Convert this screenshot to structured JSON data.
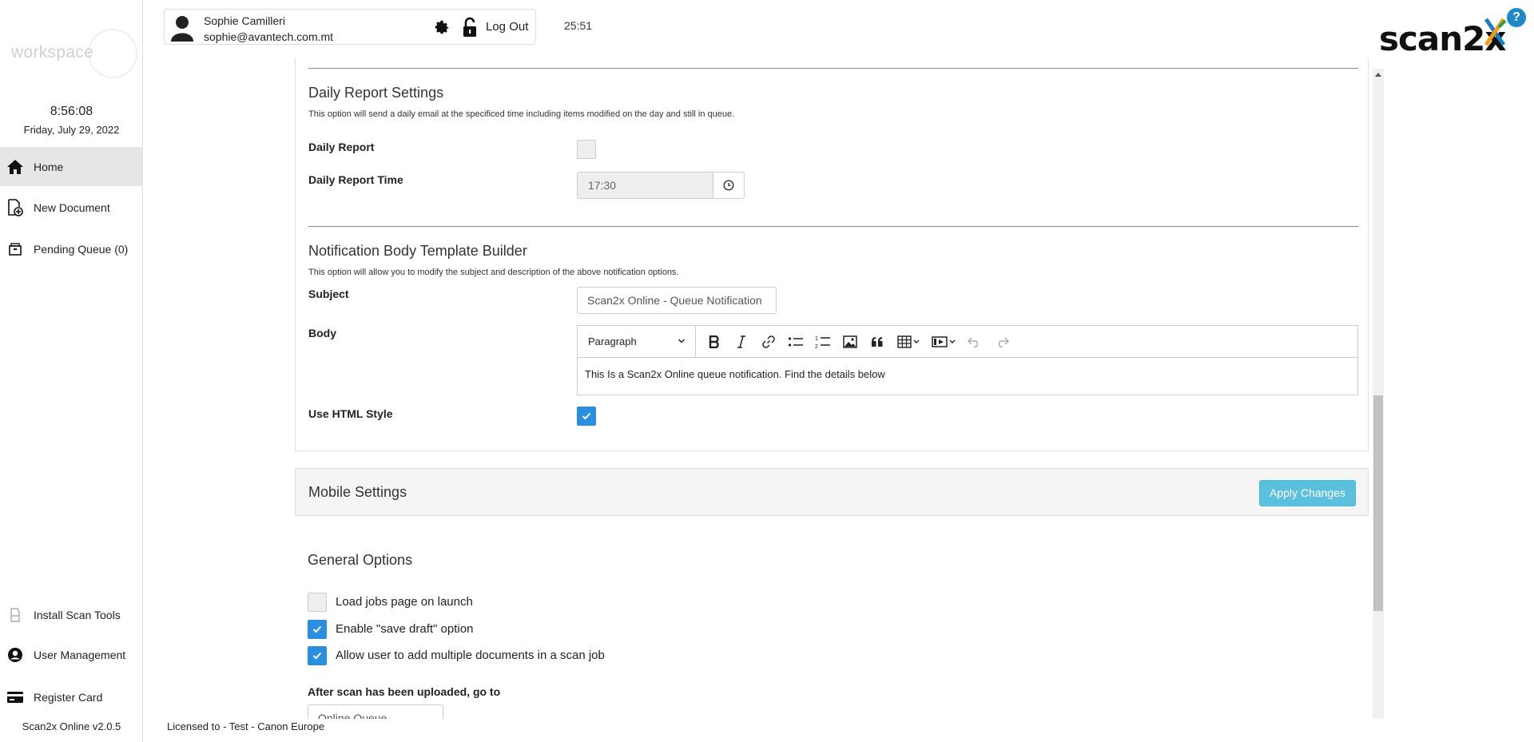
{
  "app": {
    "logo_text": "workspace",
    "logo_subtext": "",
    "brand": "scan2x",
    "version": "Scan2x Online v2.0.5",
    "license": "Licensed to - Test - Canon Europe"
  },
  "sidebar": {
    "clock": "8:56:08",
    "date": "Friday, July 29, 2022",
    "items": [
      {
        "label": "Home",
        "icon": "home-icon"
      },
      {
        "label": "New Document",
        "icon": "new-document-icon"
      },
      {
        "label": "Pending Queue (0)",
        "icon": "pending-queue-icon"
      },
      {
        "label": "Install Scan Tools",
        "icon": "scanner-icon"
      },
      {
        "label": "User Management",
        "icon": "user-icon"
      },
      {
        "label": "Register Card",
        "icon": "card-icon"
      }
    ]
  },
  "header": {
    "user_name": "Sophie Camilleri",
    "user_email": "sophie@avantech.com.mt",
    "logout": "Log Out",
    "timer": "25:51",
    "help": "?"
  },
  "daily_report": {
    "title": "Daily Report Settings",
    "description": "This option will send a daily email at the specificed time including items modified on the day and still in queue.",
    "daily_report_label": "Daily Report",
    "daily_report_checked": false,
    "time_label": "Daily Report Time",
    "time_value": "17:30"
  },
  "template_builder": {
    "title": "Notification Body Template Builder",
    "description": "This option will allow you to modify the subject and description of the above notification options.",
    "subject_label": "Subject",
    "subject_value": "Scan2x Online - Queue Notification",
    "body_label": "Body",
    "paragraph_select": "Paragraph",
    "body_text": "This Is a Scan2x Online queue notification. Find the details below",
    "html_style_label": "Use HTML Style",
    "html_style_checked": true
  },
  "mobile_settings": {
    "title": "Mobile Settings",
    "apply_button": "Apply Changes",
    "general_title": "General Options",
    "options": [
      {
        "label": "Load jobs page on launch",
        "checked": false
      },
      {
        "label": "Enable \"save draft\" option",
        "checked": true
      },
      {
        "label": "Allow user to add multiple documents in a scan job",
        "checked": true
      }
    ],
    "after_upload_label": "After scan has been uploaded, go to",
    "after_upload_value": "Online Queue"
  },
  "colors": {
    "accent": "#2a8fe0",
    "apply_button": "#5bc0de",
    "active_nav": "#e6e6e6"
  }
}
